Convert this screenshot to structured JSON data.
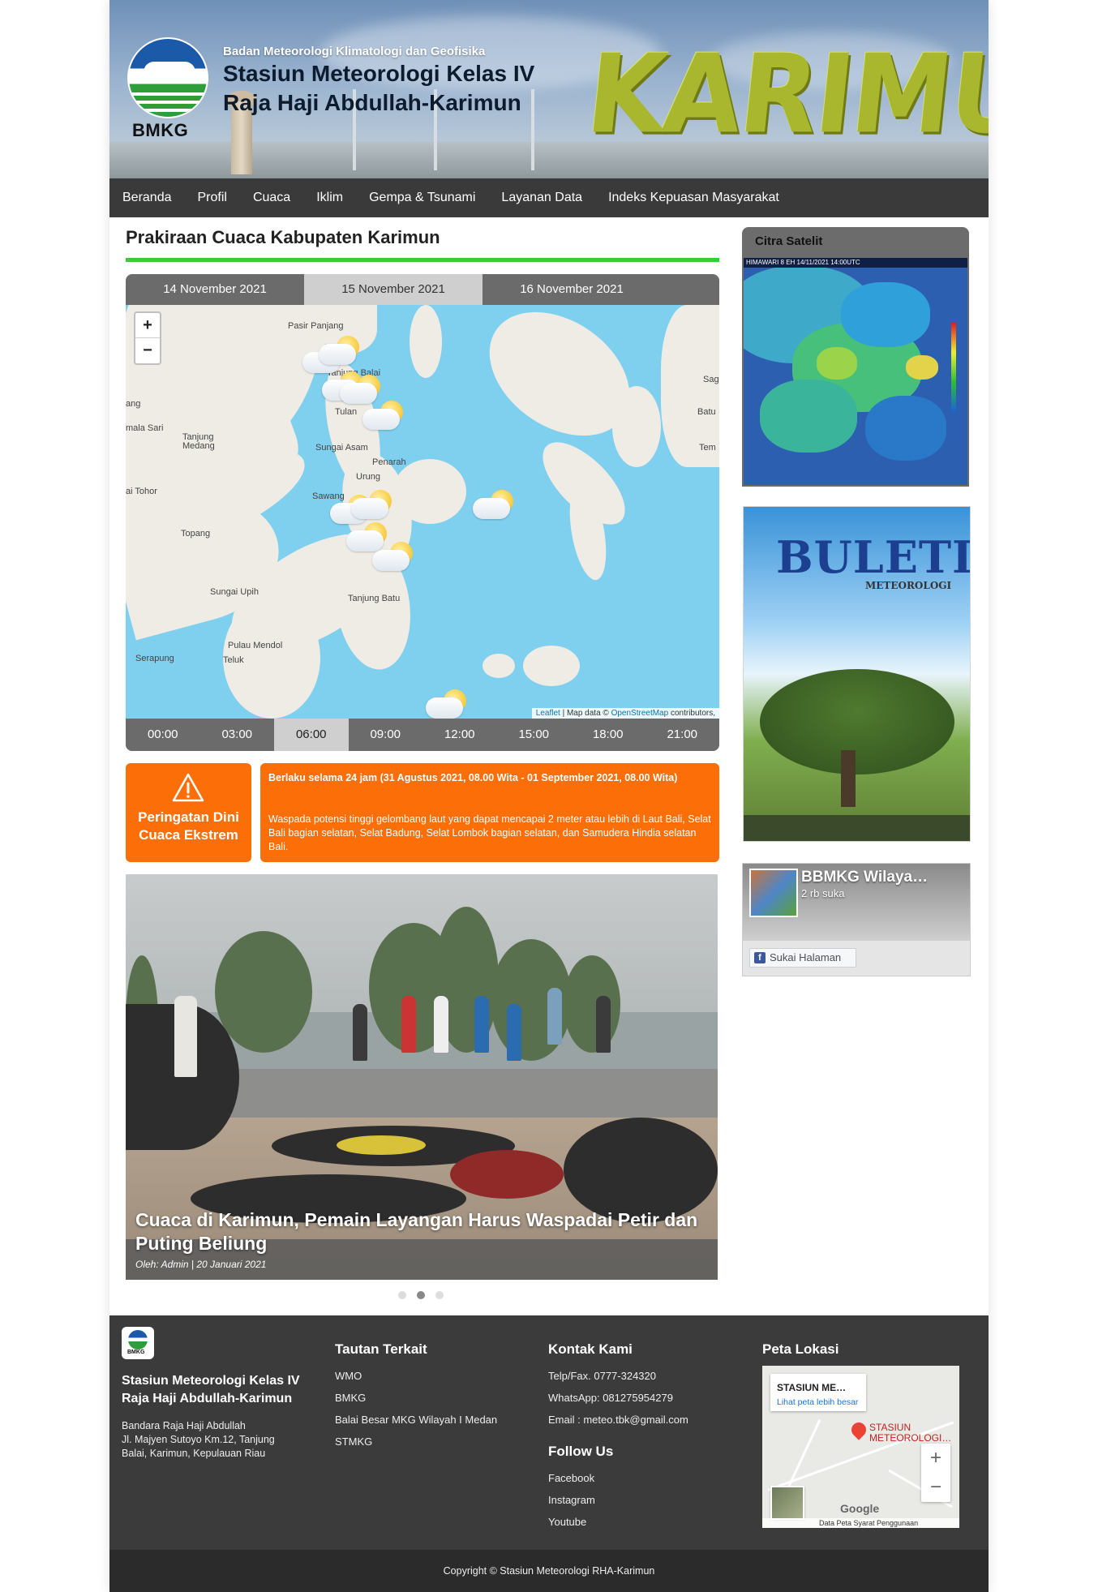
{
  "header": {
    "logo_text": "BMKG",
    "agency": "Badan Meteorologi Klimatologi dan Geofisika",
    "station_line1": "Stasiun Meteorologi Kelas IV",
    "station_line2": "Raja Haji Abdullah-Karimun",
    "banner_word": "KARIMUN"
  },
  "nav": {
    "items": [
      "Beranda",
      "Profil",
      "Cuaca",
      "Iklim",
      "Gempa & Tsunami",
      "Layanan Data",
      "Indeks Kepuasan Masyarakat"
    ]
  },
  "forecast": {
    "title": "Prakiraan Cuaca Kabupaten Karimun",
    "days": [
      "14 November 2021",
      "15 November 2021",
      "16 November 2021"
    ],
    "active_day": 1,
    "times": [
      "00:00",
      "03:00",
      "06:00",
      "09:00",
      "12:00",
      "15:00",
      "18:00",
      "21:00"
    ],
    "active_time": 2,
    "zoom_in": "+",
    "zoom_out": "−",
    "map_labels": [
      "Pasir Panjang",
      "Tanjung Balai",
      "Tulan",
      "Sungai Asam",
      "Penarah",
      "Urung",
      "Sawang",
      "Tanjung Batu",
      "Sungai Upih",
      "Pulau Mendol",
      "Teluk",
      "Serapung",
      "Topang",
      "Tanjung Medang",
      "ang",
      "mala Sari",
      "ai Tohor",
      "Sag",
      "Batu",
      "Tem"
    ],
    "attribution_leaflet": "Leaflet",
    "attribution_text": " | Map data © ",
    "attribution_osm": "OpenStreetMap",
    "attribution_tail": " contributors,"
  },
  "alert": {
    "label": "Peringatan Dini Cuaca Ekstrem",
    "heading": "Berlaku selama 24 jam (31 Agustus 2021, 08.00 Wita - 01 September 2021, 08.00 Wita)",
    "body": "Waspada potensi tinggi gelombang laut yang dapat mencapai 2 meter atau lebih di Laut Bali, Selat Bali bagian selatan, Selat Badung, Selat Lombok bagian selatan, dan Samudera Hindia selatan Bali."
  },
  "news": {
    "title": "Cuaca di Karimun, Pemain Layangan Harus Waspadai Petir dan Puting Beliung",
    "meta": "Oleh: Admin | 20 Januari 2021",
    "slides": 3,
    "active_slide": 1
  },
  "sidebar": {
    "satellite_title": "Citra Satelit",
    "satellite_caption": "HIMAWARI 8 EH 14/11/2021 14:00UTC",
    "bulletin_title": "BULETIN",
    "bulletin_subtitle": "METEOROLOGI",
    "fb_name": "BBMKG Wilaya…",
    "fb_likes": "2 rb suka",
    "fb_button": "Sukai Halaman"
  },
  "footer": {
    "logo_text": "BMKG",
    "station_line1": "Stasiun Meteorologi Kelas IV",
    "station_line2": "Raja Haji Abdullah-Karimun",
    "address": [
      "Bandara Raja Haji Abdullah",
      "Jl. Majyen Sutoyo Km.12, Tanjung",
      "Balai, Karimun, Kepulauan Riau"
    ],
    "links_title": "Tautan Terkait",
    "links": [
      "WMO",
      "BMKG",
      "Balai Besar MKG Wilayah I Medan",
      "STMKG"
    ],
    "contact_title": "Kontak Kami",
    "contact": [
      "Telp/Fax. 0777-324320",
      "WhatsApp: 081275954279",
      "Email : meteo.tbk@gmail.com"
    ],
    "follow_title": "Follow Us",
    "follow": [
      "Facebook",
      "Instagram",
      "Youtube"
    ],
    "map_title": "Peta Lokasi",
    "map_card_name": "STASIUN ME…",
    "map_card_link": "Lihat peta lebih besar",
    "map_pin_label": "STASIUN METEOROLOGI…",
    "map_google": "Google",
    "map_bottom": "Data Peta    Syarat Penggunaan",
    "copyright": "Copyright © Stasiun Meteorologi RHA-Karimun"
  },
  "colors": {
    "nav_bg": "#3a3a3a",
    "accent_green": "#3cc93c",
    "alert_orange": "#fb6e08",
    "footer_bg": "#3b3b3b",
    "sea": "#7fcfee"
  }
}
